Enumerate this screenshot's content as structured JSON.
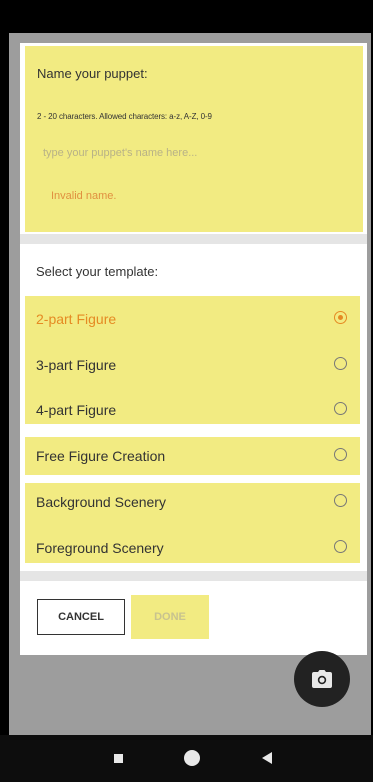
{
  "name_section": {
    "title": "Name your puppet:",
    "hint": "2 - 20 characters. Allowed characters: a-z, A-Z, 0-9",
    "input_placeholder": "type your puppet's name here...",
    "input_value": "",
    "error": "Invalid name."
  },
  "template_section": {
    "title": "Select your template:",
    "options": [
      {
        "label": "2-part Figure",
        "selected": true
      },
      {
        "label": "3-part Figure",
        "selected": false
      },
      {
        "label": "4-part Figure",
        "selected": false
      },
      {
        "label": "Free Figure Creation",
        "selected": false
      },
      {
        "label": "Background Scenery",
        "selected": false
      },
      {
        "label": "Foreground Scenery",
        "selected": false
      }
    ]
  },
  "actions": {
    "cancel_label": "CANCEL",
    "done_label": "DONE"
  },
  "icons": {
    "fab": "camera-icon",
    "nav_recents": "square-icon",
    "nav_home": "circle-icon",
    "nav_back": "back-triangle-icon"
  },
  "colors": {
    "highlight": "#f2eb82",
    "accent": "#e58a23",
    "error": "#e09040"
  }
}
